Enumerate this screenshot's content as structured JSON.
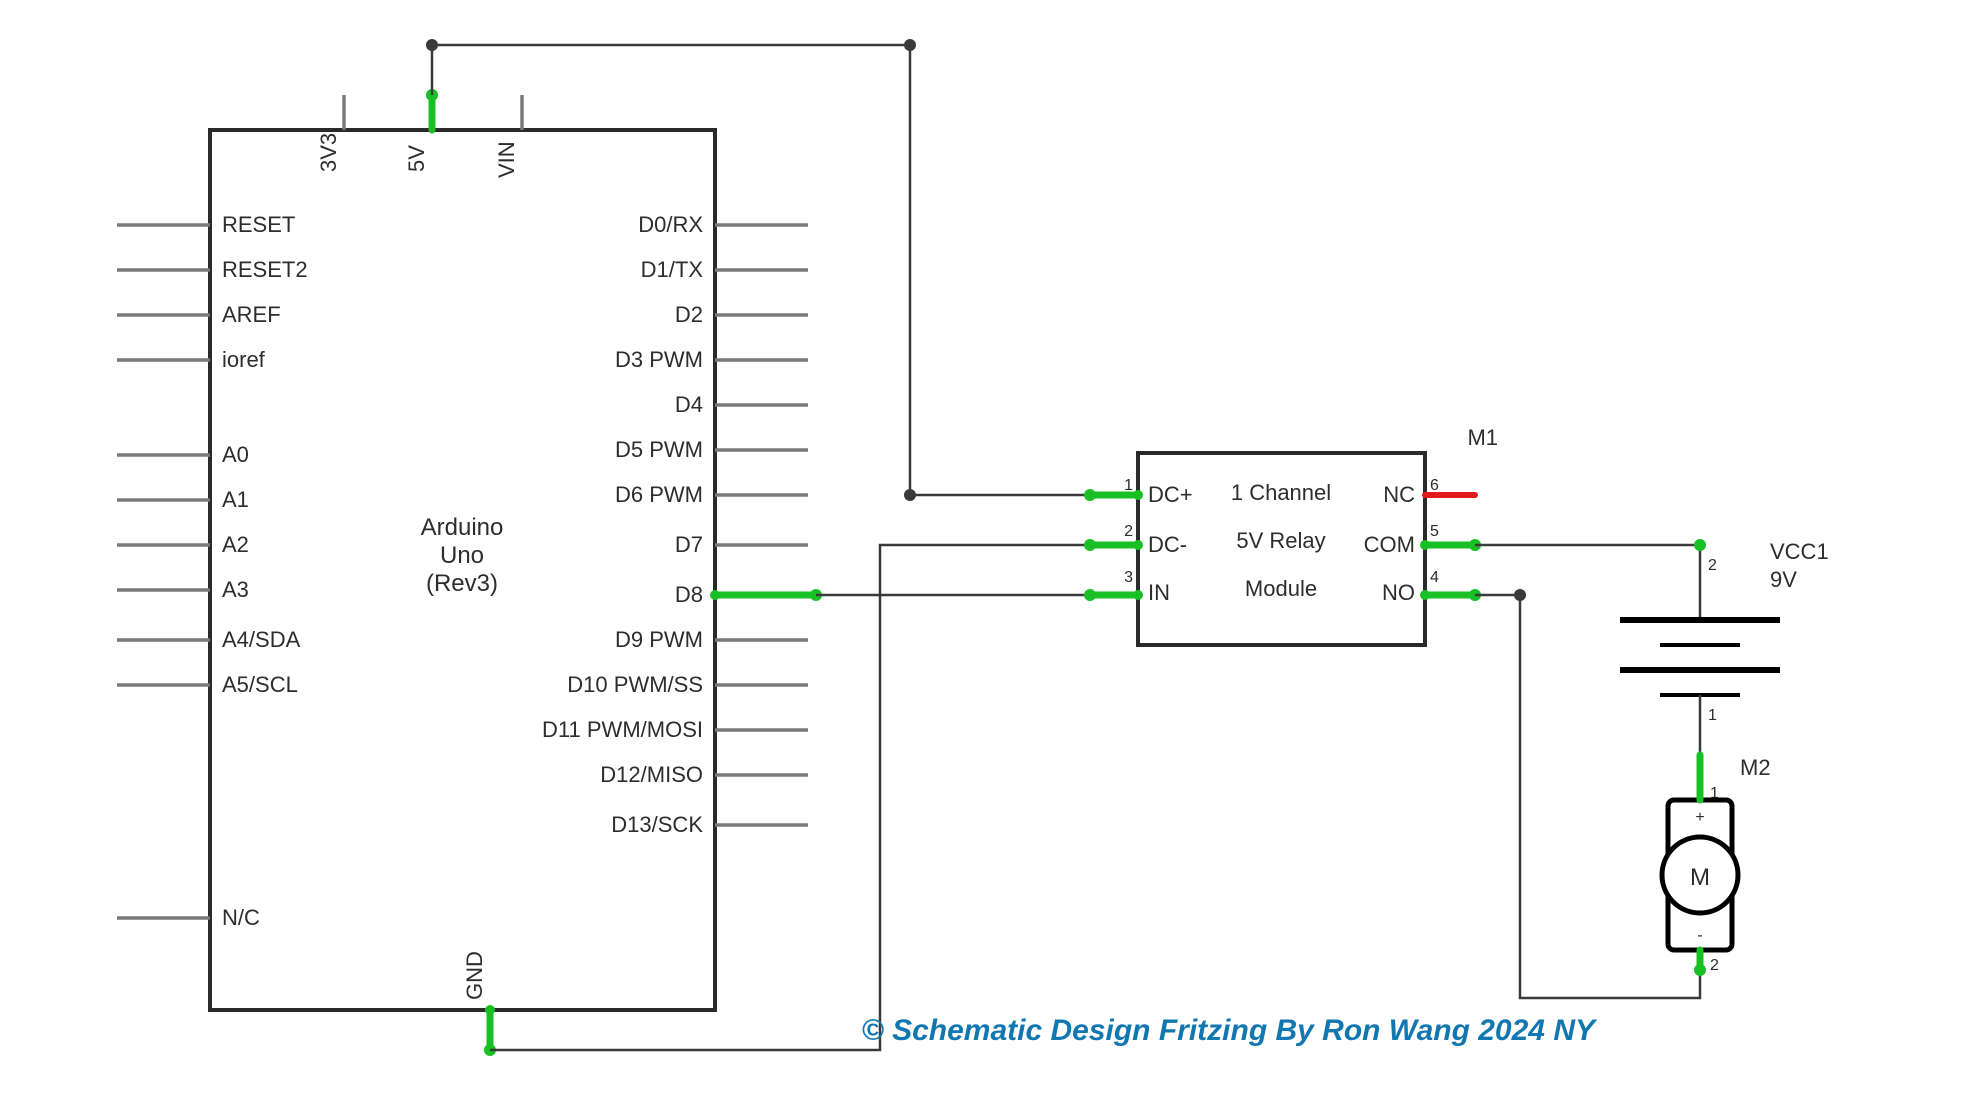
{
  "arduino": {
    "name_line1": "Arduino",
    "name_line2": "Uno",
    "name_line3": "(Rev3)",
    "top_pins": {
      "p3v3": "3V3",
      "p5v": "5V",
      "pvin": "VIN"
    },
    "left_pins": {
      "reset": "RESET",
      "reset2": "RESET2",
      "aref": "AREF",
      "ioref": "ioref",
      "a0": "A0",
      "a1": "A1",
      "a2": "A2",
      "a3": "A3",
      "a4": "A4/SDA",
      "a5": "A5/SCL",
      "nc": "N/C"
    },
    "right_pins": {
      "d0": "D0/RX",
      "d1": "D1/TX",
      "d2": "D2",
      "d3": "D3 PWM",
      "d4": "D4",
      "d5": "D5 PWM",
      "d6": "D6 PWM",
      "d7": "D7",
      "d8": "D8",
      "d9": "D9 PWM",
      "d10": "D10 PWM/SS",
      "d11": "D11 PWM/MOSI",
      "d12": "D12/MISO",
      "d13": "D13/SCK"
    },
    "bottom_pins": {
      "gnd": "GND"
    }
  },
  "relay": {
    "ref": "M1",
    "title_line1": "1 Channel",
    "title_line2": "5V Relay",
    "title_line3": "Module",
    "left_pins": {
      "dcp": "DC+",
      "dcm": "DC-",
      "in": "IN"
    },
    "left_num": {
      "dcp": "1",
      "dcm": "2",
      "in": "3"
    },
    "right_pins": {
      "nc": "NC",
      "com": "COM",
      "no": "NO"
    },
    "right_num": {
      "nc": "6",
      "com": "5",
      "no": "4"
    }
  },
  "battery": {
    "ref": "VCC1",
    "value": "9V",
    "pin_top": "2",
    "pin_bot": "1"
  },
  "motor": {
    "ref": "M2",
    "letter": "M",
    "plus": "+",
    "minus": "-",
    "pin_top": "1",
    "pin_bot": "2"
  },
  "caption": "© Schematic Design Fritzing By Ron Wang 2024 NY",
  "colors": {
    "accent_green": "#18c025",
    "accent_red": "#e31b1c",
    "caption_blue": "#1177b0"
  }
}
